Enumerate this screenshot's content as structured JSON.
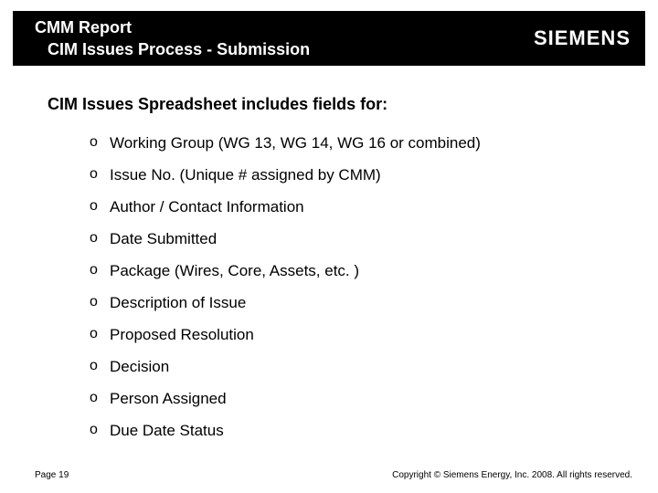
{
  "header": {
    "title_main": "CMM Report",
    "title_sub": "CIM Issues Process - Submission",
    "logo_text": "SIEMENS"
  },
  "body": {
    "intro": "CIM Issues Spreadsheet includes fields for:",
    "items": [
      "Working Group (WG 13, WG 14, WG 16 or combined)",
      "Issue No. (Unique # assigned by CMM)",
      "Author / Contact Information",
      "Date Submitted",
      "Package (Wires, Core, Assets, etc. )",
      "Description of Issue",
      "Proposed Resolution",
      "Decision",
      "Person Assigned",
      "Due Date Status"
    ]
  },
  "footer": {
    "page_label": "Page 19",
    "copyright": "Copyright © Siemens Energy, Inc. 2008. All rights reserved."
  }
}
